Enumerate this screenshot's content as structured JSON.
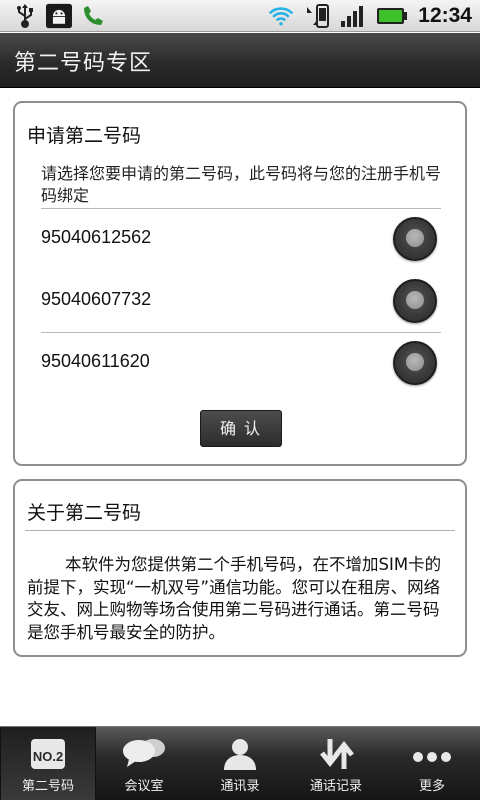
{
  "status_bar": {
    "time": "12:34",
    "left_icons": [
      "usb-icon",
      "android-debug-icon",
      "phone-call-icon"
    ],
    "right_icons": [
      "wifi-icon",
      "data-transfer-icon",
      "signal-icon",
      "battery-icon"
    ],
    "battery_color": "#3fbf2a"
  },
  "header": {
    "title": "第二号码专区"
  },
  "apply_section": {
    "heading": "申请第二号码",
    "description": "请选择您要申请的第二号码，此号码将与您的注册手机号码绑定",
    "numbers": [
      {
        "number": "95040612562",
        "selected": false
      },
      {
        "number": "95040607732",
        "selected": false
      },
      {
        "number": "95040611620",
        "selected": false
      }
    ],
    "confirm_label": "确认"
  },
  "about_section": {
    "heading": "关于第二号码",
    "text": "本软件为您提供第二个手机号码，在不增加SIM卡的前提下，实现“一机双号”通信功能。您可以在租房、网络交友、网上购物等场合使用第二号码进行通话。第二号码是您手机号最安全的防护。"
  },
  "bottom_nav": {
    "items": [
      {
        "label": "第二号码",
        "icon": "no2-icon",
        "active": true
      },
      {
        "label": "会议室",
        "icon": "chat-bubbles-icon",
        "active": false
      },
      {
        "label": "通讯录",
        "icon": "contact-person-icon",
        "active": false
      },
      {
        "label": "通话记录",
        "icon": "call-log-arrows-icon",
        "active": false
      },
      {
        "label": "更多",
        "icon": "more-dots-icon",
        "active": false
      }
    ],
    "no2_badge": "NO.2"
  }
}
